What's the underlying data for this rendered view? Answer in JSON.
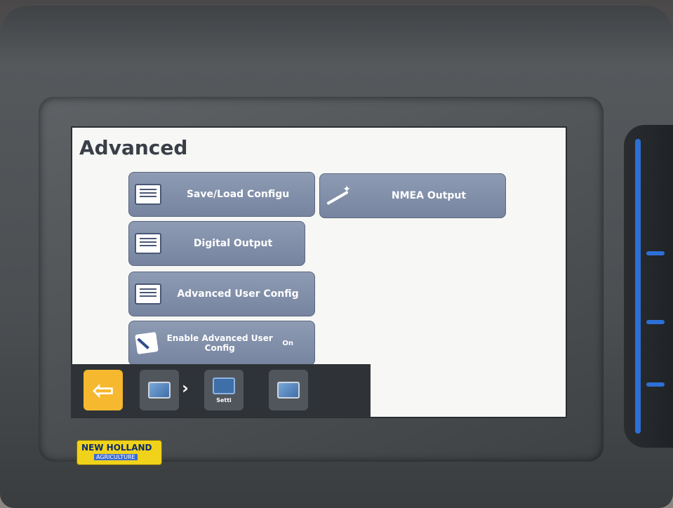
{
  "screen": {
    "title": "Advanced"
  },
  "tiles": [
    {
      "label": "Save/Load Configu",
      "icon": "list-icon"
    },
    {
      "label": "NMEA Output",
      "icon": "wand-icon"
    },
    {
      "label": "Digital Output",
      "icon": "list-icon"
    },
    {
      "label": "Advanced User Config",
      "icon": "list-icon"
    },
    {
      "label": "Enable Advanced User Config",
      "state": "On",
      "icon": "pencil-icon"
    }
  ],
  "toolbar": {
    "back_icon": "arrow-left",
    "crumbs": [
      {
        "label": "",
        "icon": "monitor-icon"
      },
      {
        "label": "Setti",
        "icon": "wrench-icon"
      },
      {
        "label": "",
        "icon": "monitor-icon"
      }
    ],
    "separator": "›"
  },
  "device": {
    "brand": "NEW HOLLAND",
    "brand_sub": "AGRICULTURE"
  },
  "colors": {
    "tile": "#8390ab",
    "back_button": "#f5b82f",
    "accent_blue": "#2d6fd6"
  }
}
